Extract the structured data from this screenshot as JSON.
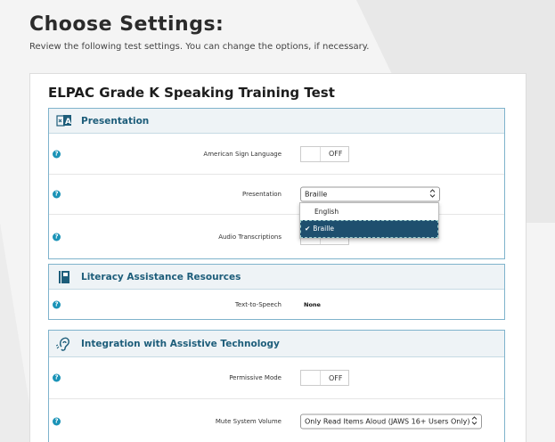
{
  "page": {
    "title": "Choose Settings:",
    "subtitle": "Review the following test settings. You can change the options, if necessary."
  },
  "test": {
    "title": "ELPAC Grade K Speaking Training Test"
  },
  "sections": [
    {
      "title": "Presentation",
      "icon": "sign-language-icon",
      "rows": [
        {
          "label": "American Sign Language",
          "control": "toggle",
          "value": "OFF"
        },
        {
          "label": "Presentation",
          "control": "select",
          "value": "Braille"
        },
        {
          "label": "Audio Transcriptions",
          "control": "toggle",
          "value": "OFF"
        }
      ]
    },
    {
      "title": "Literacy Assistance Resources",
      "icon": "book-icon",
      "rows": [
        {
          "label": "Text-to-Speech",
          "control": "text",
          "value": "None"
        }
      ]
    },
    {
      "title": "Integration with Assistive Technology",
      "icon": "ear-icon",
      "rows": [
        {
          "label": "Permissive Mode",
          "control": "toggle",
          "value": "OFF"
        },
        {
          "label": "Mute System Volume",
          "control": "select",
          "value": "Only Read Items Aloud (JAWS 16+ Users Only)"
        }
      ]
    }
  ],
  "dropdown": {
    "options": [
      "English",
      "Braille"
    ],
    "selected": "Braille"
  },
  "help_glyph": "?",
  "chevron_glyph": "⌃⌄",
  "check_glyph": "✔",
  "colors": {
    "accent": "#1a93b7",
    "section_title": "#1d5d7a",
    "section_border": "#7fb3cc",
    "dropdown_selected": "#1e4f6e"
  }
}
